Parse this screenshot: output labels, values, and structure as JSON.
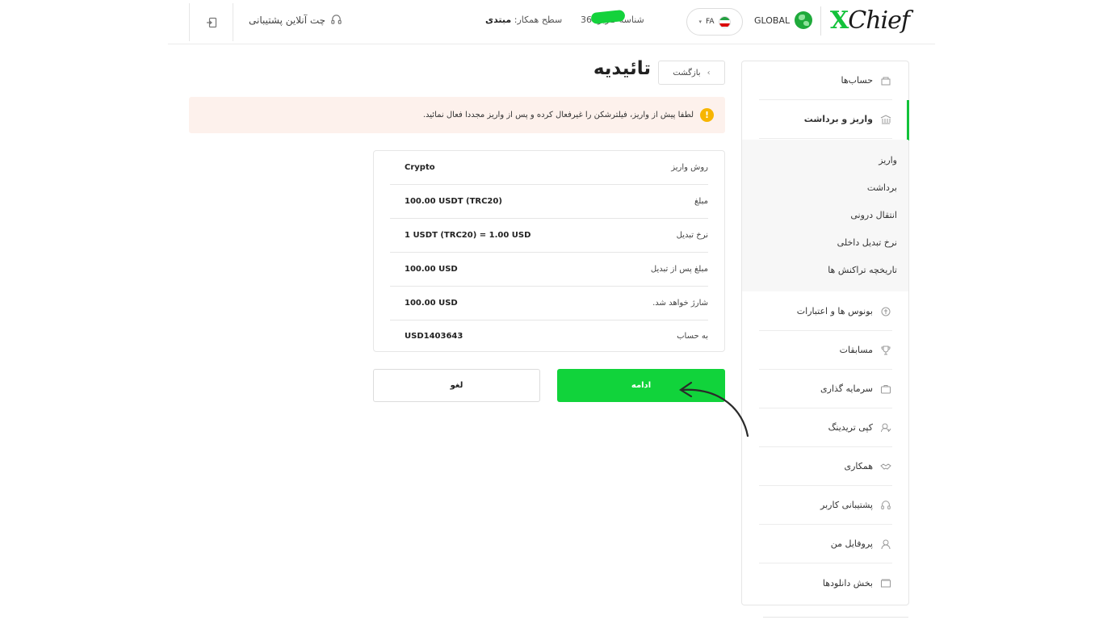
{
  "header": {
    "chat_label": "چت آنلاین پشتیبانی",
    "partner_level_label": "سطح همکار:",
    "partner_level_value": "مبتدی",
    "user_id_label": "شناسه کاربر:",
    "user_id_value": "36",
    "lang": "FA",
    "region": "GLOBAL",
    "logo_x": "X",
    "logo_rest": "Chief",
    "icons": {
      "logout": "logout-icon",
      "chat": "headset-icon",
      "lang_caret": "chevron-down-icon",
      "flag": "iran-flag-icon",
      "globe": "globe-icon"
    }
  },
  "sidebar": {
    "items": [
      {
        "label": "حساب‌ها",
        "icon": "wallet-icon"
      },
      {
        "label": "واریز و برداشت",
        "icon": "bank-icon",
        "active": true
      },
      {
        "label": "بونوس ها و اعتبارات",
        "icon": "gift-icon"
      },
      {
        "label": "مسابقات",
        "icon": "trophy-icon"
      },
      {
        "label": "سرمایه گذاری",
        "icon": "briefcase-icon"
      },
      {
        "label": "کپی تریدینگ",
        "icon": "copy-user-icon"
      },
      {
        "label": "همکاری",
        "icon": "handshake-icon"
      },
      {
        "label": "پشتیبانی کاربر",
        "icon": "headset-icon"
      },
      {
        "label": "پروفایل من",
        "icon": "user-icon"
      },
      {
        "label": "بخش دانلودها",
        "icon": "download-icon"
      }
    ],
    "sub_items": [
      "واریز",
      "برداشت",
      "انتقال درونی",
      "نرخ تبدیل داخلی",
      "تاریخچه تراکنش ها"
    ],
    "accent": "#12c23a"
  },
  "main": {
    "back_label": "بازگشت",
    "title": "تائیدیه",
    "alert_text": "لطفا پیش از واریز، فیلترشکن را غیرفعال کرده و پس از واریز مجددا فعال نمائید.",
    "alert_icon": "warning-icon",
    "details": [
      {
        "label": "روش واریز",
        "value": "Crypto"
      },
      {
        "label": "مبلغ",
        "value": "100.00 USDT (TRC20)"
      },
      {
        "label": "نرخ تبدیل",
        "value": "1 USDT (TRC20) = 1.00 USD"
      },
      {
        "label": "مبلغ پس از تبدیل",
        "value": "100.00 USD"
      },
      {
        "label": "شارژ خواهد شد.",
        "value": "100.00 USD"
      },
      {
        "label": "به حساب",
        "value": "USD1403643"
      }
    ],
    "cancel_label": "لغو",
    "continue_label": "ادامه",
    "continue_color": "#11d33b"
  }
}
